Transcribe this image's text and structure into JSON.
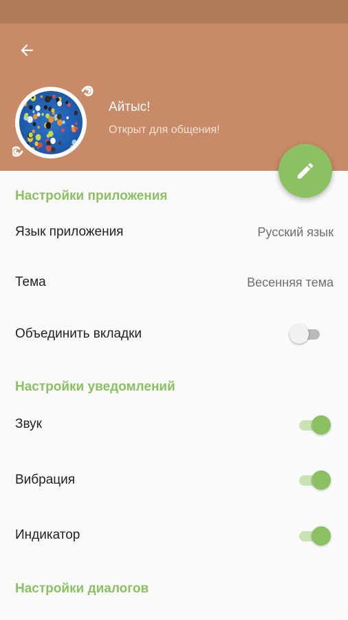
{
  "colors": {
    "header": "#c88a67",
    "statusbar": "#b07b58",
    "accent": "#8bc163",
    "background": "#fafafa"
  },
  "header": {
    "back_icon": "arrow-left-icon",
    "name": "Айтыс!",
    "status": "Открыт для общения!",
    "edit_icon": "pencil-icon"
  },
  "sections": {
    "app": {
      "title": "Настройки приложения",
      "language_label": "Язык приложения",
      "language_value": "Русский язык",
      "theme_label": "Тема",
      "theme_value": "Весенняя тема",
      "merge_tabs_label": "Объединить вкладки",
      "merge_tabs_on": false
    },
    "notifications": {
      "title": "Настройки уведомлений",
      "sound_label": "Звук",
      "sound_on": true,
      "vibration_label": "Вибрация",
      "vibration_on": true,
      "indicator_label": "Индикатор",
      "indicator_on": true
    },
    "dialogs": {
      "title": "Настройки диалогов"
    }
  }
}
